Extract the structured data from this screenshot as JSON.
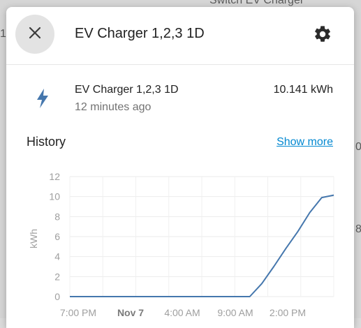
{
  "background": {
    "fragment_top": "Switch EV Charger",
    "fragment_left": "1",
    "fragment_right_1": "0",
    "fragment_right_2": "8"
  },
  "dialog": {
    "close_icon": "close-icon",
    "title": "EV Charger 1,2,3 1D",
    "settings_icon": "gear-icon"
  },
  "entity": {
    "icon": "lightning-bolt-icon",
    "name": "EV Charger 1,2,3 1D",
    "last_changed": "12 minutes ago",
    "state": "10.141 kWh"
  },
  "history": {
    "title": "History",
    "show_more": "Show more"
  },
  "colors": {
    "accent": "#4577ad",
    "link": "#0288d1"
  },
  "chart_data": {
    "type": "line",
    "ylabel": "kWh",
    "y_ticks": [
      "0",
      "2",
      "4",
      "6",
      "8",
      "10",
      "12"
    ],
    "ylim": [
      0,
      12
    ],
    "x_tick_labels": [
      "7:00 PM",
      "Nov 7",
      "4:00 AM",
      "9:00 AM",
      "2:00 PM"
    ],
    "grid": true,
    "series": [
      {
        "x": [
          0,
          1,
          2,
          3,
          4,
          5,
          6,
          7,
          8,
          9,
          10,
          11,
          12,
          13,
          14,
          15,
          16,
          17,
          18,
          19,
          20,
          21,
          22
        ],
        "values": [
          0,
          0,
          0,
          0,
          0,
          0,
          0,
          0,
          0,
          0,
          0,
          0,
          0,
          0,
          0,
          0,
          1.3,
          3.0,
          4.8,
          6.5,
          8.4,
          9.9,
          10.141
        ]
      }
    ]
  }
}
